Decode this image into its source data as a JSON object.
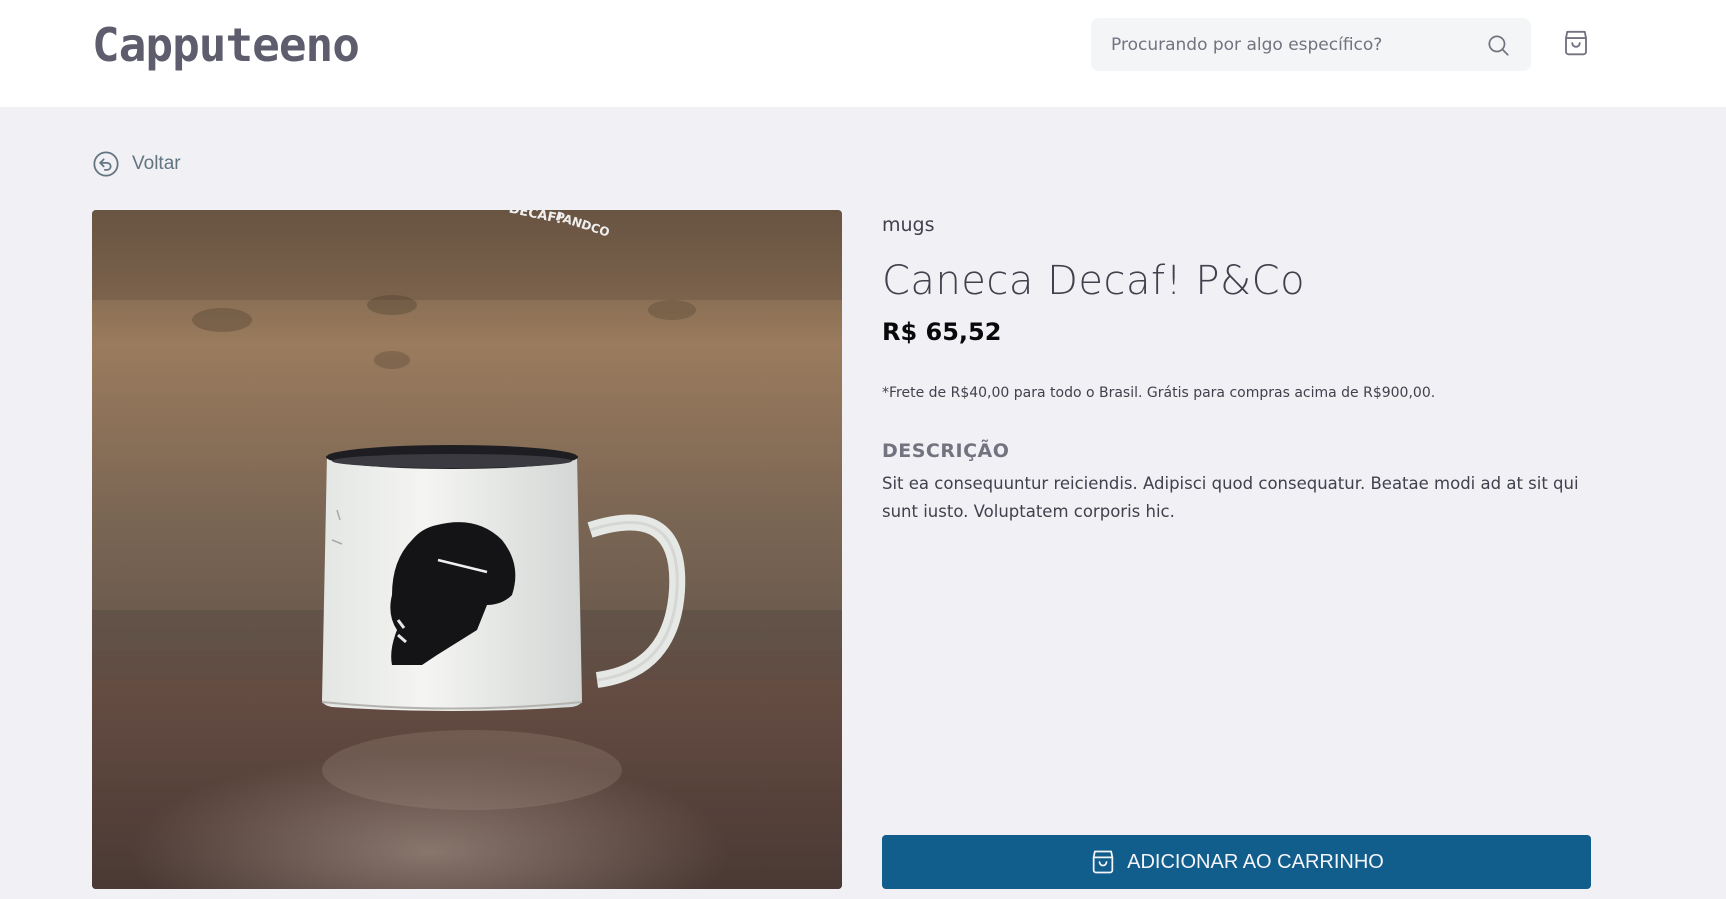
{
  "header": {
    "logo": "Capputeeno",
    "search": {
      "placeholder": "Procurando por algo específico?"
    }
  },
  "nav": {
    "back_label": "Voltar"
  },
  "product": {
    "category": "mugs",
    "name": "Caneca Decaf! P&Co",
    "price": "R$ 65,52",
    "shipping_note": "*Frete de R$40,00 para todo o Brasil. Grátis para compras acima de R$900,00.",
    "description_title": "DESCRIÇÃO",
    "description": "Sit ea consequuntur reiciendis. Adipisci quod consequatur. Beatae modi ad at sit qui sunt iusto. Voluptatem corporis hic.",
    "image_text": [
      "DECAF!",
      "PANDCO"
    ],
    "add_to_cart_label": "ADICIONAR AO CARRINHO"
  },
  "colors": {
    "primary": "#115d8c",
    "background": "#f0f0f5",
    "text": "#41414d",
    "muted": "#737380"
  },
  "icons": {
    "search": "search-icon",
    "cart": "shopping-bag-icon",
    "back": "back-arrow-circle-icon",
    "add_to_cart": "shopping-bag-icon"
  }
}
